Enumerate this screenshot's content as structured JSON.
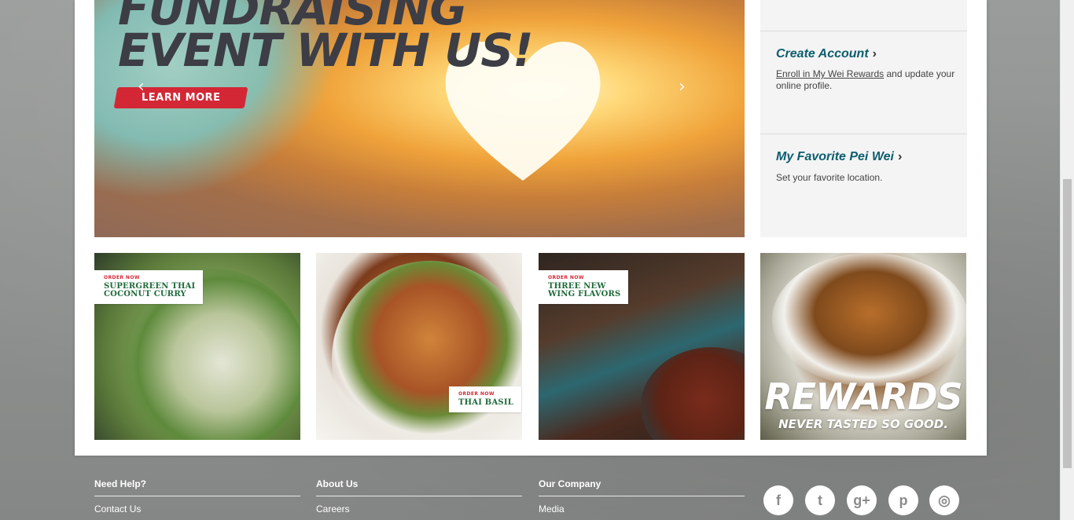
{
  "hero": {
    "line1": "FUNDRAISING",
    "line2": "EVENT WITH US!",
    "cta_label": "LEARN MORE",
    "prev_arrow": "‹",
    "next_arrow": "›"
  },
  "sidebar": {
    "create_account": {
      "title": "Create Account",
      "chevron": "›",
      "link_text": "Enroll in My Wei Rewards",
      "desc_rest": " and update your online profile."
    },
    "favorite": {
      "title": "My Favorite Pei Wei",
      "chevron": "›",
      "desc": "Set your favorite location."
    }
  },
  "tiles": [
    {
      "tag": "ORDER NOW",
      "name_line1": "SUPERGREEN THAI",
      "name_line2": "COCONUT CURRY"
    },
    {
      "tag": "ORDER NOW",
      "name_line1": "THAI BASIL",
      "name_line2": ""
    },
    {
      "tag": "ORDER NOW",
      "name_line1": "THREE NEW",
      "name_line2": "WING FLAVORS"
    },
    {
      "big": "REWARDS",
      "sub": "NEVER TASTED SO GOOD."
    }
  ],
  "footer": {
    "cols": [
      {
        "title": "Need Help?",
        "link": "Contact Us"
      },
      {
        "title": "About Us",
        "link": "Careers"
      },
      {
        "title": "Our Company",
        "link": "Media"
      }
    ],
    "social": [
      {
        "icon": "facebook-icon",
        "glyph": "f"
      },
      {
        "icon": "twitter-icon",
        "glyph": "t"
      },
      {
        "icon": "google-plus-icon",
        "glyph": "g+"
      },
      {
        "icon": "pinterest-icon",
        "glyph": "p"
      },
      {
        "icon": "instagram-icon",
        "glyph": "◎"
      }
    ]
  },
  "colors": {
    "accent_red": "#d32736",
    "teal_title": "#0c5d6e",
    "tag_green": "#1f6b3b"
  }
}
